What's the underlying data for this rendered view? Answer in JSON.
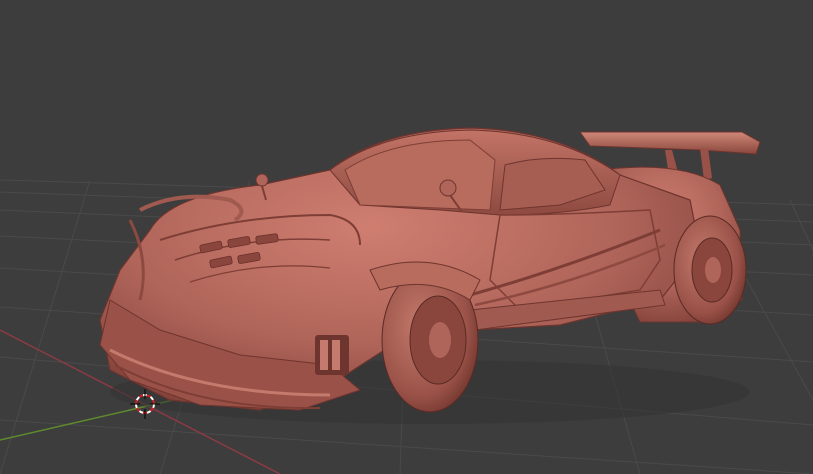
{
  "viewport": {
    "background_color": "#3d3d3d",
    "grid_color": "#4a4a4a",
    "x_axis_color": "#8a3a45",
    "y_axis_color": "#5e8a2e"
  },
  "scene": {
    "object": "sculpted-car-model",
    "material_color": "#b8685c",
    "shadow_color": "#6e342e",
    "highlight_color": "#d88a7c"
  },
  "cursor": {
    "icon": "3d-cursor-icon",
    "ring_color_a": "#ffffff",
    "ring_color_b": "#d02020"
  }
}
